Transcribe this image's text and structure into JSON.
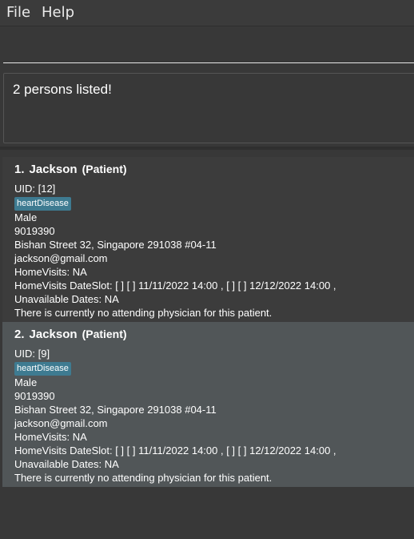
{
  "menu": {
    "file": "File",
    "help": "Help"
  },
  "command": {
    "value": "",
    "placeholder": ""
  },
  "result": {
    "message": "2 persons listed!"
  },
  "persons": [
    {
      "index": "1.",
      "name": "Jackson",
      "type": "(Patient)",
      "uid": "UID: [12]",
      "tag": "heartDisease",
      "gender": "Male",
      "phone": "9019390",
      "address": "Bishan Street 32, Singapore 291038 #04-11",
      "email": "jackson@gmail.com",
      "home_visits": "HomeVisits: NA",
      "date_slot": "HomeVisits DateSlot: [ ] [ ] 11/11/2022 14:00 , [ ] [ ] 12/12/2022 14:00 ,",
      "unavailable": "Unavailable Dates: NA",
      "physician": "There is currently no attending physician for this patient."
    },
    {
      "index": "2.",
      "name": "Jackson",
      "type": "(Patient)",
      "uid": "UID: [9]",
      "tag": "heartDisease",
      "gender": "Male",
      "phone": "9019390",
      "address": "Bishan Street 32, Singapore 291038 #04-11",
      "email": "jackson@gmail.com",
      "home_visits": "HomeVisits: NA",
      "date_slot": "HomeVisits DateSlot: [ ] [ ] 11/11/2022 14:00 , [ ] [ ] 12/12/2022 14:00 ,",
      "unavailable": "Unavailable Dates: NA",
      "physician": "There is currently no attending physician for this patient."
    }
  ]
}
